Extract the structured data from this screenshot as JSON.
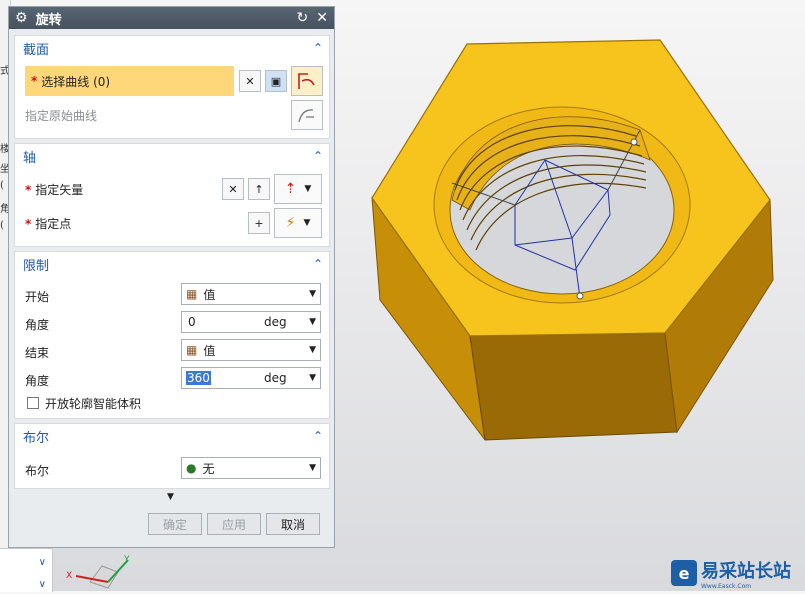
{
  "dialog": {
    "title": "旋转",
    "sections": {
      "section": {
        "title": "截面",
        "select_curve": "选择曲线 (0)",
        "specify_origin_curve": "指定原始曲线"
      },
      "axis": {
        "title": "轴",
        "specify_vector": "指定矢量",
        "specify_point": "指定点"
      },
      "limits": {
        "title": "限制",
        "start_label": "开始",
        "start_value": "值",
        "start_angle_label": "角度",
        "start_angle_value": "0",
        "start_angle_unit": "deg",
        "end_label": "结束",
        "end_value": "值",
        "end_angle_label": "角度",
        "end_angle_value": "360",
        "end_angle_unit": "deg",
        "open_profile_label": "开放轮廓智能体积",
        "open_profile_checked": false
      },
      "boolean": {
        "title": "布尔",
        "boolean_label": "布尔",
        "boolean_value": "无"
      }
    },
    "buttons": {
      "ok": "确定",
      "apply": "应用",
      "cancel": "取消"
    }
  },
  "left_strip_chars": [
    "式",
    "楼",
    "坐",
    "(",
    "角",
    "("
  ],
  "triad": {
    "x_label": "X",
    "y_label": "Y"
  },
  "watermark": {
    "text": "易采站长站",
    "subtext": "Www.Easck.Com"
  },
  "colors": {
    "accent_blue": "#1f5aa8",
    "selection_highlight": "#fdd77a",
    "nut_top": "#f6c41d",
    "nut_side": "#c78f08",
    "required_star": "#d01010"
  }
}
